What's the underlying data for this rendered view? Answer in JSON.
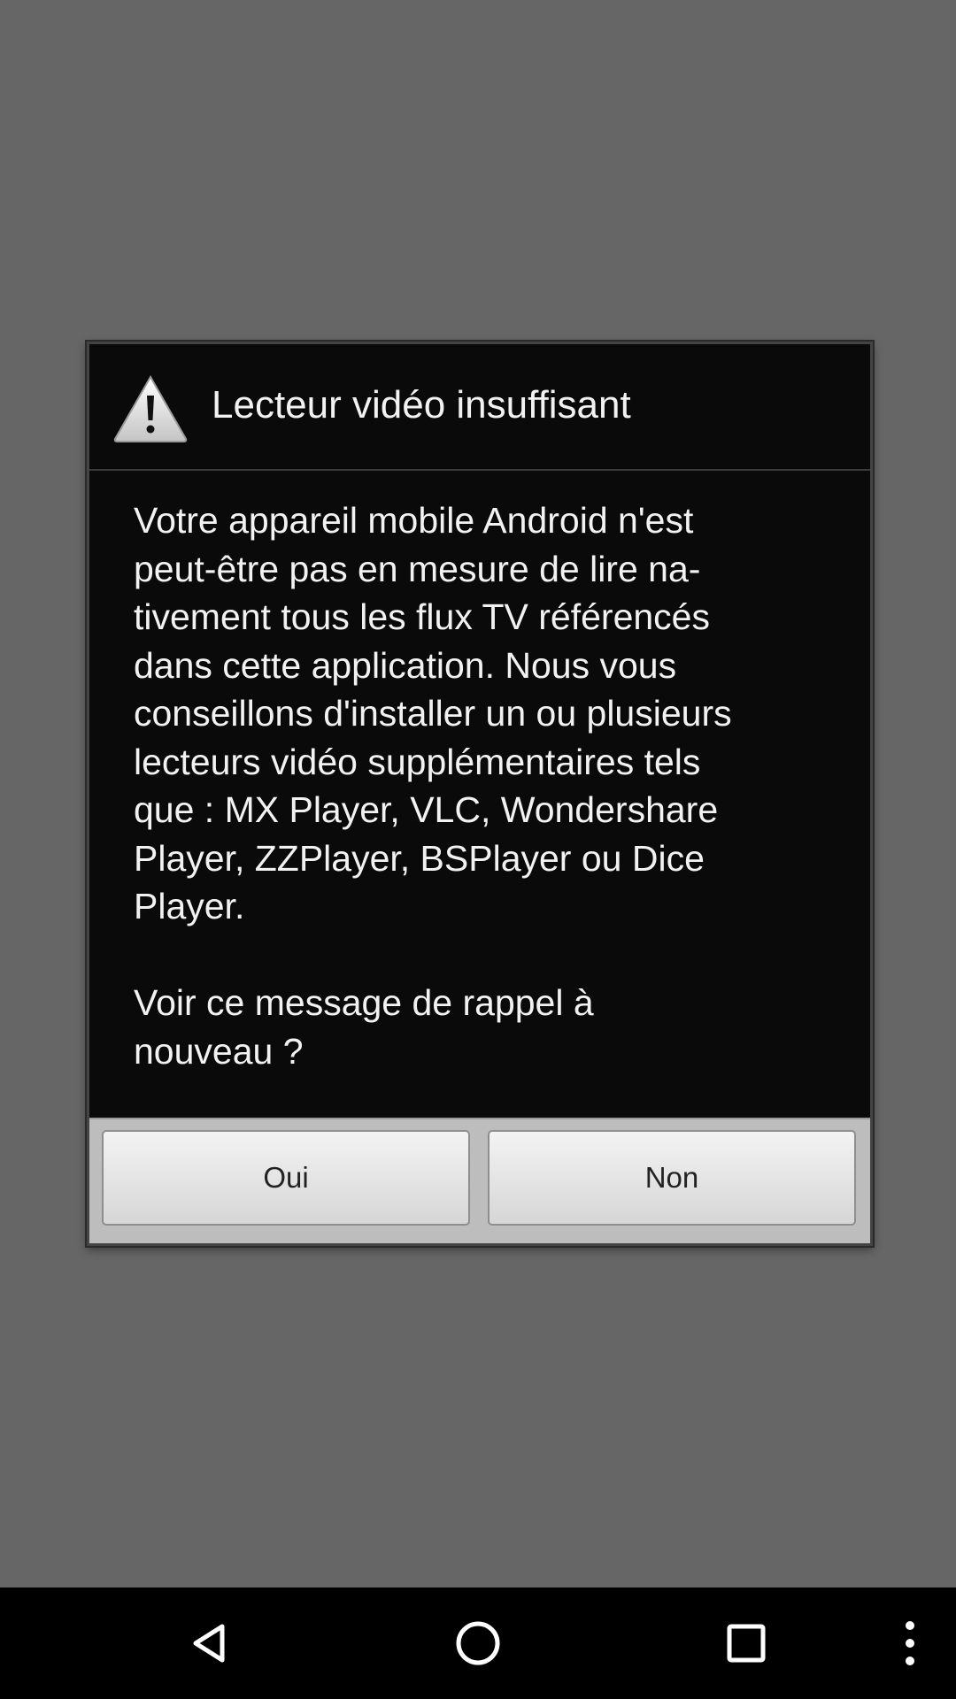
{
  "dialog": {
    "icon": "warning-icon",
    "title": "Lecteur vidéo insuffisant",
    "message_lines": [
      "Votre appareil mobile Android n'est",
      "peut-être pas en mesure de lire na-",
      "tivement tous les flux TV référencés",
      "dans cette application. Nous vous",
      "conseillons d'installer un ou plusieurs",
      "lecteurs vidéo supplémentaires tels",
      "que : MX Player, VLC, Wondershare",
      "Player, ZZPlayer, BSPlayer ou Dice",
      "Player."
    ],
    "question_lines": [
      "Voir ce message de rappel à",
      "nouveau ?"
    ],
    "buttons": {
      "yes_label": "Oui",
      "no_label": "Non"
    }
  },
  "nav_bar": {
    "icons": [
      "back-icon",
      "home-icon",
      "recents-icon",
      "overflow-menu-icon"
    ]
  },
  "colors": {
    "scrim": "#666666",
    "dialog_background": "#0a0a0a",
    "text": "#f2f2f2",
    "button_bar": "#bdbdbd",
    "nav_bar": "#000000"
  }
}
